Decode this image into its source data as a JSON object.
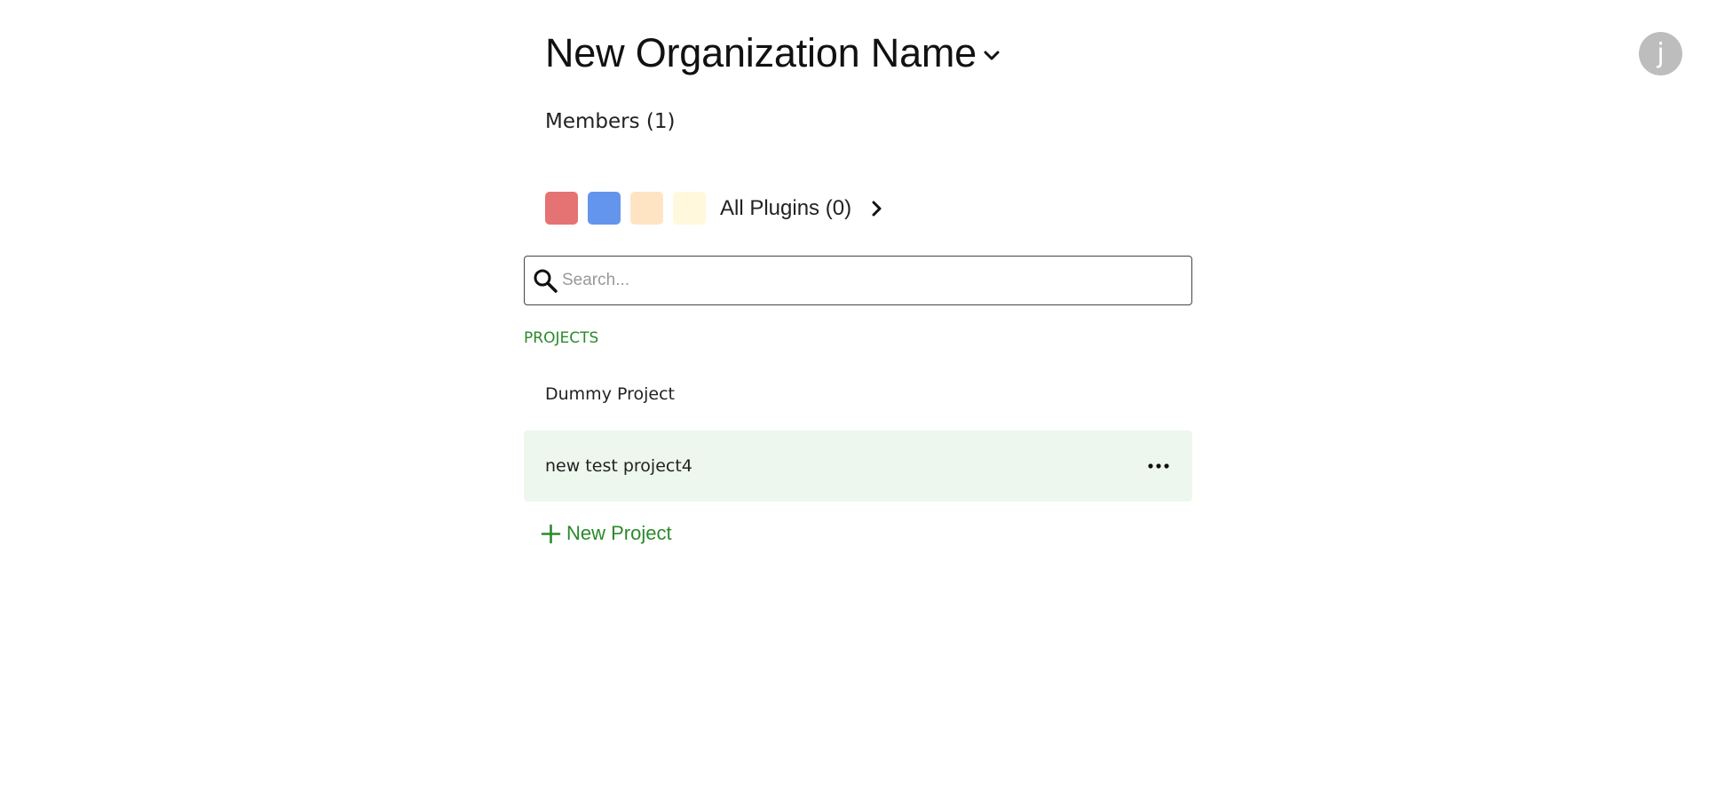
{
  "user": {
    "avatar_initial": "j"
  },
  "organization": {
    "name": "New Organization Name"
  },
  "members": {
    "label": "Members (1)"
  },
  "plugins": {
    "label": "All Plugins (0)",
    "swatch_colors": [
      "#e57373",
      "#6495ed",
      "#ffe4c4",
      "#fff8dc"
    ]
  },
  "search": {
    "placeholder": "Search...",
    "value": ""
  },
  "projects": {
    "section_label": "PROJECTS",
    "items": [
      {
        "name": "Dummy Project"
      },
      {
        "name": "new test project4"
      }
    ],
    "new_label": "New Project"
  },
  "colors": {
    "accent_green": "#2b8a2b",
    "active_row_bg": "#edf7ed",
    "avatar_bg": "#bdbdbd"
  },
  "icons": [
    "chevron-down-icon",
    "chevron-right-icon",
    "search-icon",
    "more-horizontal-icon",
    "plus-icon"
  ]
}
